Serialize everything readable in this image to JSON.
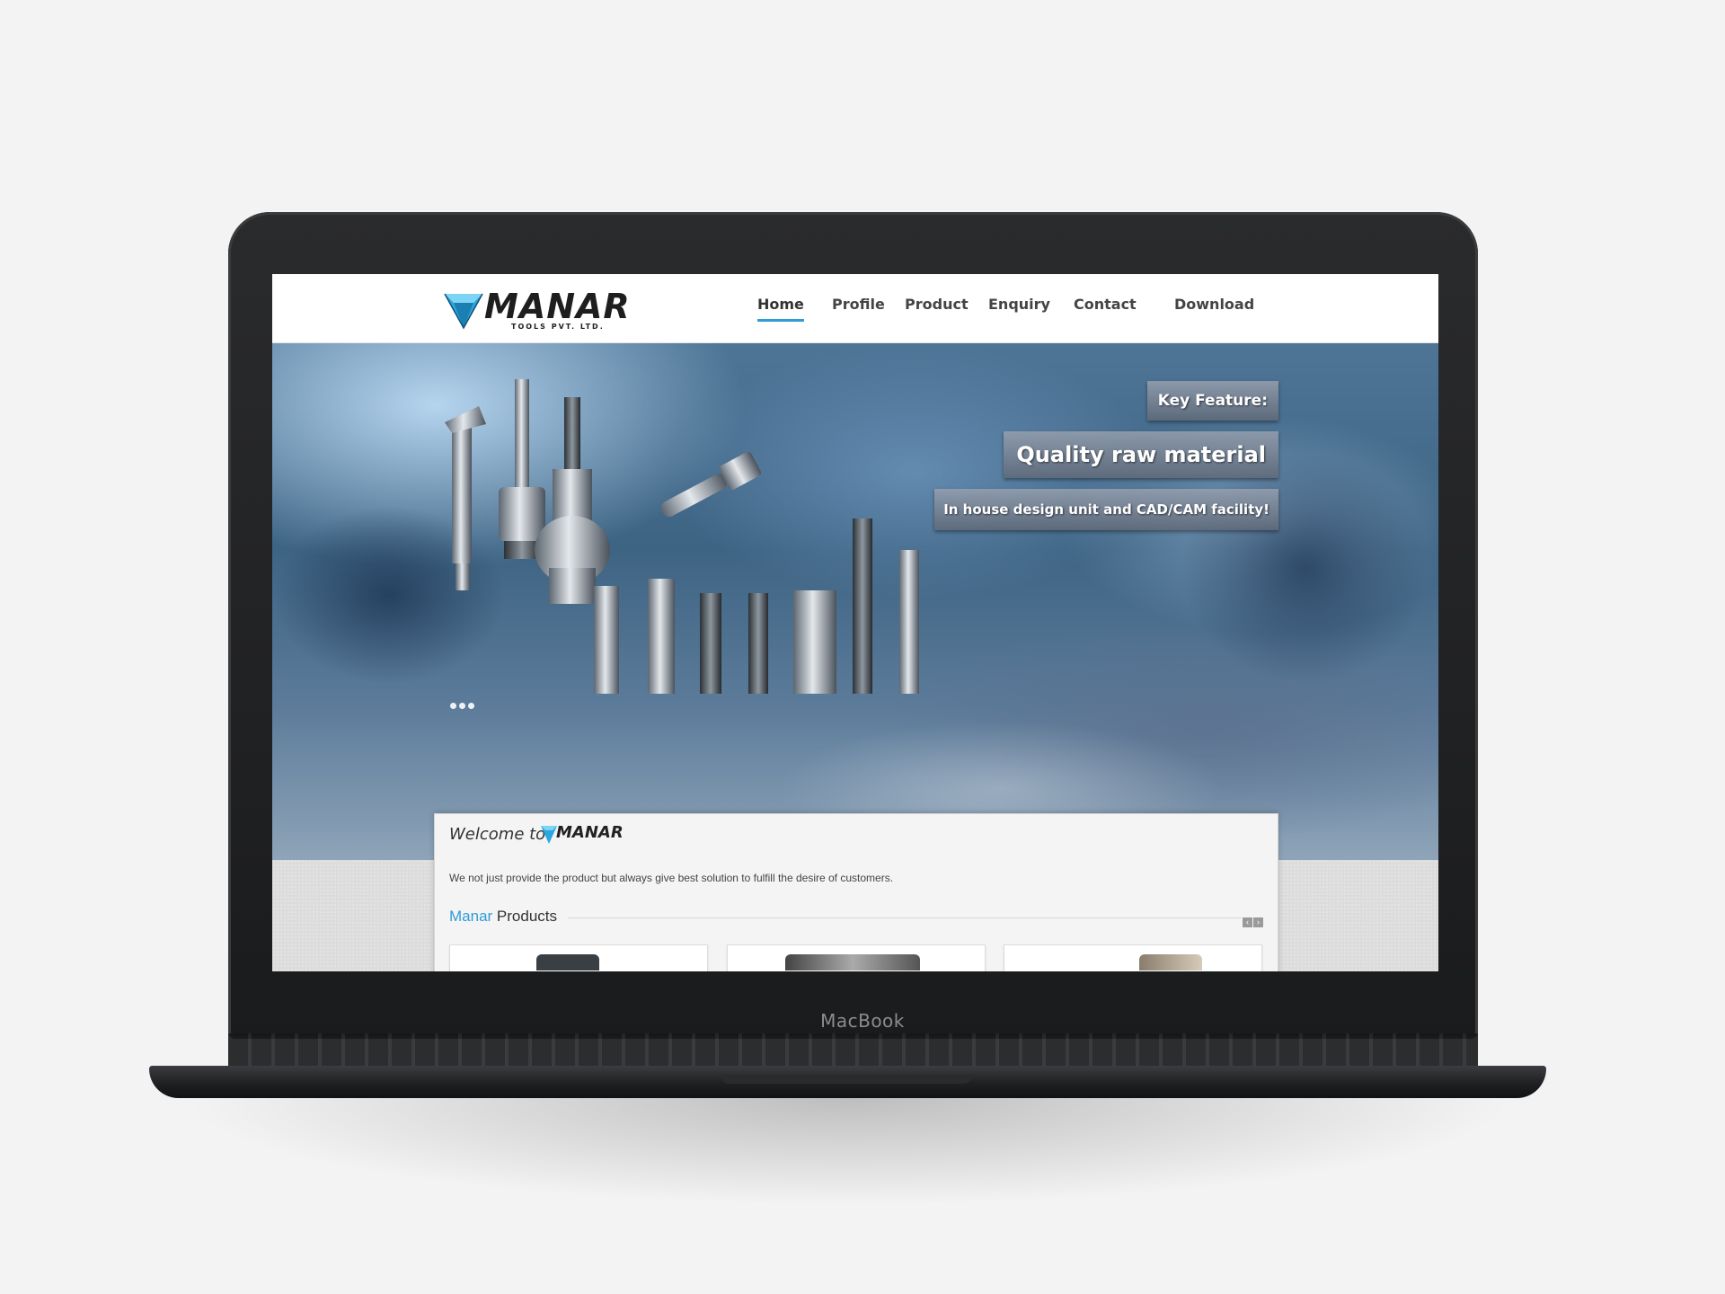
{
  "device": {
    "brand": "MacBook"
  },
  "site": {
    "logo": {
      "name": "MANAR",
      "subtitle": "TOOLS PVT. LTD."
    },
    "nav": [
      {
        "label": "Home",
        "active": true
      },
      {
        "label": "Profile",
        "active": false
      },
      {
        "label": "Product",
        "active": false
      },
      {
        "label": "Enquiry",
        "active": false
      },
      {
        "label": "Contact",
        "active": false
      },
      {
        "label": "Download",
        "active": false
      }
    ],
    "hero": {
      "feature_title": "Key Feature:",
      "feature_main": "Quality raw material",
      "feature_sub": "In house design unit and CAD/CAM facility!",
      "slide_count": 3
    },
    "welcome": {
      "prefix": "Welcome to",
      "brand": "MANAR",
      "tagline": "We not just provide the product but always give best solution to fulfill the desire of customers."
    },
    "products": {
      "brand": "Manar",
      "label": "Products",
      "prev_icon": "‹",
      "next_icon": "›"
    }
  },
  "colors": {
    "accent": "#2f9cd6",
    "gem": "#2aa7df"
  }
}
